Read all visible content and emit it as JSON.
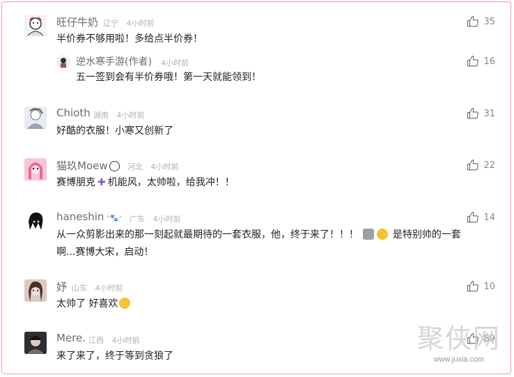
{
  "comments": [
    {
      "user": "旺仔牛奶",
      "location": "辽宁",
      "time": "4小时前",
      "text": "半价券不够用啦！多给点半价券！",
      "likes": "35",
      "reply": {
        "user": "逆水寒手游(作者)",
        "time": "4小时前",
        "text": "五一签到会有半价券哦！第一天就能领到！",
        "likes": "16"
      }
    },
    {
      "user": "Chioth",
      "location": "湖南",
      "time": "4小时前",
      "text": "好酷的衣服！小寒又创新了",
      "likes": "31"
    },
    {
      "user": "猫玖Moew",
      "location": "河北",
      "time": "4小时前",
      "text": "赛博朋克",
      "text2": "机能风，太帅啦，给我冲！！",
      "likes": "22"
    },
    {
      "user": "haneshin",
      "location": "广东",
      "time": "4小时前",
      "text": "从一众剪影出来的那一刻起就最期待的一套衣服，他，终于来了！！！",
      "text_tail": "是特别帅的一套",
      "text_line2": "啊...赛博大宋，启动！",
      "likes": "14"
    },
    {
      "user": "妤",
      "location": "山东",
      "time": "4小时前",
      "text": "太帅了 好喜欢",
      "likes": "10"
    },
    {
      "user": "Mere.",
      "location": "江西",
      "time": "4小时前",
      "text": "来了来了，终于等到贪狼了",
      "likes": "89"
    }
  ],
  "watermark": {
    "big": "聚侠网",
    "small": "www.juxia.com"
  },
  "icons": {
    "like": "thumb-up-icon"
  }
}
